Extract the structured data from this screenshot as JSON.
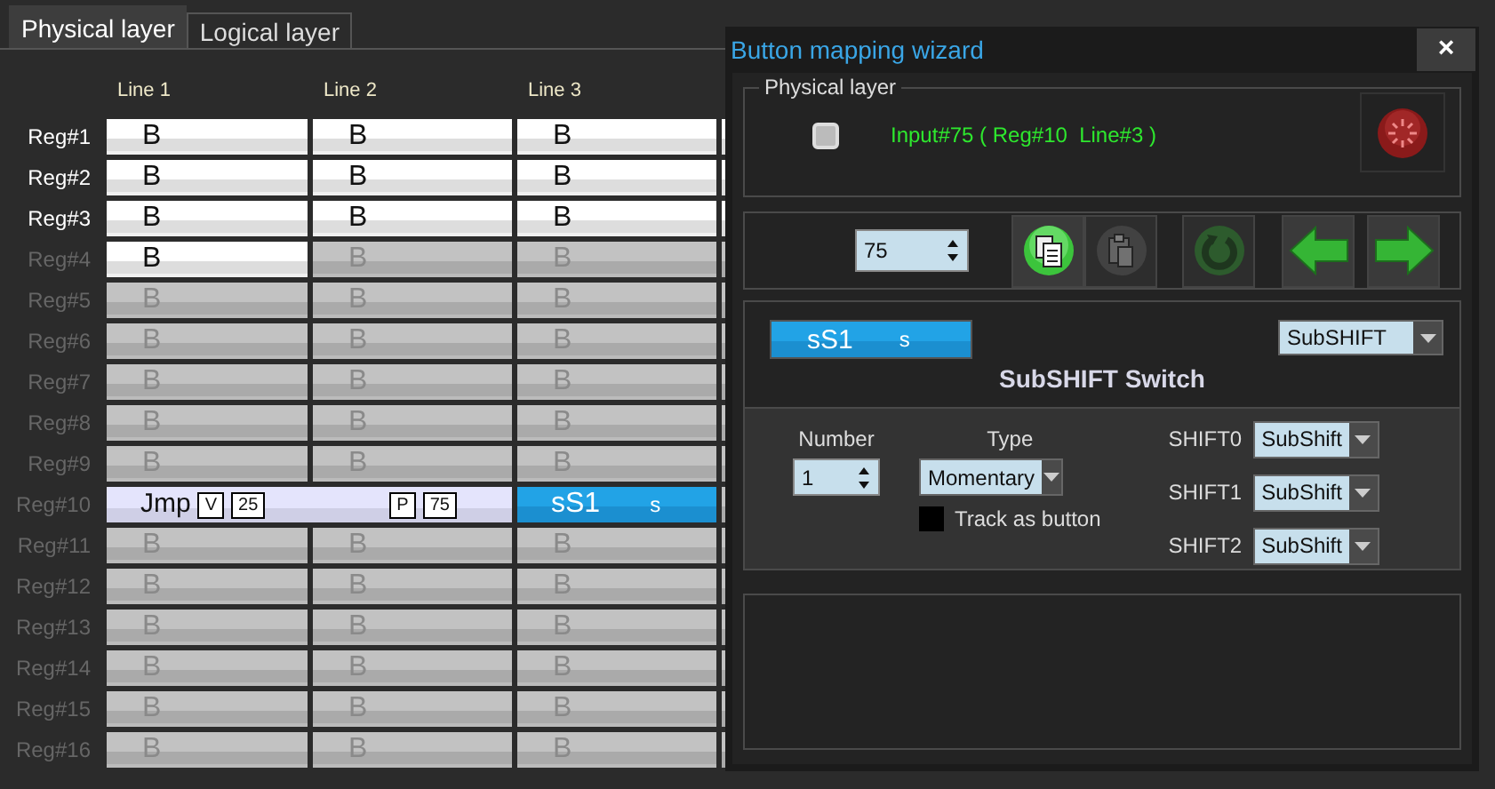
{
  "tabs": [
    {
      "label": "Physical layer",
      "selected": true
    },
    {
      "label": "Logical layer",
      "selected": false
    }
  ],
  "grid": {
    "columns": [
      "Line 1",
      "Line 2",
      "Line 3"
    ],
    "rows": [
      {
        "label": "Reg#1",
        "enabled": true,
        "cells": [
          {
            "kind": "button",
            "text": "B",
            "enabled": true
          },
          {
            "kind": "button",
            "text": "B",
            "enabled": true
          },
          {
            "kind": "button",
            "text": "B",
            "enabled": true
          }
        ]
      },
      {
        "label": "Reg#2",
        "enabled": true,
        "cells": [
          {
            "kind": "button",
            "text": "B",
            "enabled": true
          },
          {
            "kind": "button",
            "text": "B",
            "enabled": true
          },
          {
            "kind": "button",
            "text": "B",
            "enabled": true
          }
        ]
      },
      {
        "label": "Reg#3",
        "enabled": true,
        "cells": [
          {
            "kind": "button",
            "text": "B",
            "enabled": true
          },
          {
            "kind": "button",
            "text": "B",
            "enabled": true
          },
          {
            "kind": "button",
            "text": "B",
            "enabled": true
          }
        ]
      },
      {
        "label": "Reg#4",
        "enabled": false,
        "cells": [
          {
            "kind": "button",
            "text": "B",
            "enabled": true
          },
          {
            "kind": "button",
            "text": "B",
            "enabled": false
          },
          {
            "kind": "button",
            "text": "B",
            "enabled": false
          }
        ]
      },
      {
        "label": "Reg#5",
        "enabled": false,
        "cells": [
          {
            "kind": "button",
            "text": "B",
            "enabled": false
          },
          {
            "kind": "button",
            "text": "B",
            "enabled": false
          },
          {
            "kind": "button",
            "text": "B",
            "enabled": false
          }
        ]
      },
      {
        "label": "Reg#6",
        "enabled": false,
        "cells": [
          {
            "kind": "button",
            "text": "B",
            "enabled": false
          },
          {
            "kind": "button",
            "text": "B",
            "enabled": false
          },
          {
            "kind": "button",
            "text": "B",
            "enabled": false
          }
        ]
      },
      {
        "label": "Reg#7",
        "enabled": false,
        "cells": [
          {
            "kind": "button",
            "text": "B",
            "enabled": false
          },
          {
            "kind": "button",
            "text": "B",
            "enabled": false
          },
          {
            "kind": "button",
            "text": "B",
            "enabled": false
          }
        ]
      },
      {
        "label": "Reg#8",
        "enabled": false,
        "cells": [
          {
            "kind": "button",
            "text": "B",
            "enabled": false
          },
          {
            "kind": "button",
            "text": "B",
            "enabled": false
          },
          {
            "kind": "button",
            "text": "B",
            "enabled": false
          }
        ]
      },
      {
        "label": "Reg#9",
        "enabled": false,
        "cells": [
          {
            "kind": "button",
            "text": "B",
            "enabled": false
          },
          {
            "kind": "button",
            "text": "B",
            "enabled": false
          },
          {
            "kind": "button",
            "text": "B",
            "enabled": false
          }
        ]
      },
      {
        "label": "Reg#10",
        "enabled": false,
        "cells": [
          {
            "kind": "jump",
            "text": "Jmp",
            "badges": [
              "V",
              "25",
              "P",
              "75"
            ]
          },
          {
            "kind": "merged"
          },
          {
            "kind": "shift",
            "text": "sS1",
            "mode": "s"
          }
        ]
      },
      {
        "label": "Reg#11",
        "enabled": false,
        "cells": [
          {
            "kind": "button",
            "text": "B",
            "enabled": false
          },
          {
            "kind": "button",
            "text": "B",
            "enabled": false
          },
          {
            "kind": "button",
            "text": "B",
            "enabled": false
          }
        ]
      },
      {
        "label": "Reg#12",
        "enabled": false,
        "cells": [
          {
            "kind": "button",
            "text": "B",
            "enabled": false
          },
          {
            "kind": "button",
            "text": "B",
            "enabled": false
          },
          {
            "kind": "button",
            "text": "B",
            "enabled": false
          }
        ]
      },
      {
        "label": "Reg#13",
        "enabled": false,
        "cells": [
          {
            "kind": "button",
            "text": "B",
            "enabled": false
          },
          {
            "kind": "button",
            "text": "B",
            "enabled": false
          },
          {
            "kind": "button",
            "text": "B",
            "enabled": false
          }
        ]
      },
      {
        "label": "Reg#14",
        "enabled": false,
        "cells": [
          {
            "kind": "button",
            "text": "B",
            "enabled": false
          },
          {
            "kind": "button",
            "text": "B",
            "enabled": false
          },
          {
            "kind": "button",
            "text": "B",
            "enabled": false
          }
        ]
      },
      {
        "label": "Reg#15",
        "enabled": false,
        "cells": [
          {
            "kind": "button",
            "text": "B",
            "enabled": false
          },
          {
            "kind": "button",
            "text": "B",
            "enabled": false
          },
          {
            "kind": "button",
            "text": "B",
            "enabled": false
          }
        ]
      },
      {
        "label": "Reg#16",
        "enabled": false,
        "cells": [
          {
            "kind": "button",
            "text": "B",
            "enabled": false
          },
          {
            "kind": "button",
            "text": "B",
            "enabled": false
          },
          {
            "kind": "button",
            "text": "B",
            "enabled": false
          }
        ]
      }
    ]
  },
  "wizard": {
    "title": "Button mapping wizard",
    "close": "×",
    "physical": {
      "title": "Physical layer",
      "indicator_on": false,
      "input_text": "Input#75 ( Reg#10  Line#3 )",
      "reset_enabled": false
    },
    "toolbar": {
      "input_number": "75",
      "buttons": [
        {
          "kind": "copy",
          "enabled": true
        },
        {
          "kind": "paste",
          "enabled": false
        },
        {
          "kind": "undo",
          "enabled": false
        },
        {
          "kind": "prev",
          "enabled": true
        },
        {
          "kind": "next",
          "enabled": true
        }
      ]
    },
    "function": {
      "preview_text": "sS1",
      "preview_mode": "s",
      "function_type": "SubSHIFT",
      "heading": "SubSHIFT Switch",
      "number_label": "Number",
      "number": "1",
      "type_label": "Type",
      "type": "Momentary",
      "track_label": "Track as button",
      "track_checked": false,
      "shifts": [
        {
          "label": "SHIFT0",
          "value": "SubShift"
        },
        {
          "label": "SHIFT1",
          "value": "SubShift"
        },
        {
          "label": "SHIFT2",
          "value": "SubShift"
        }
      ]
    }
  }
}
